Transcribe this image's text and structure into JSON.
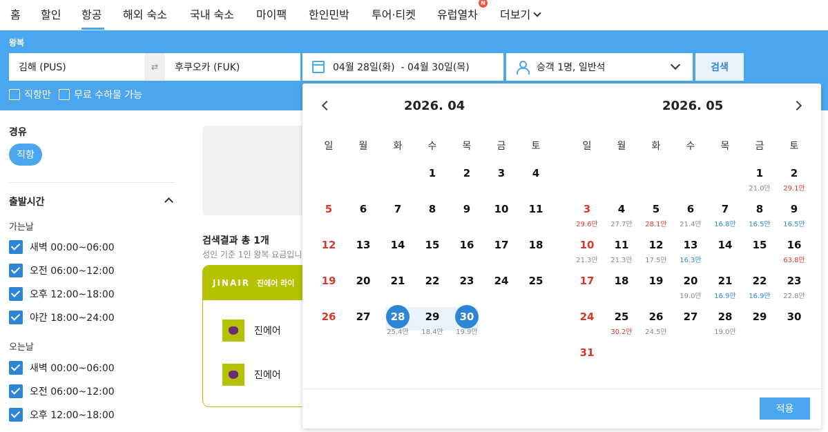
{
  "nav": {
    "items": [
      "홈",
      "할인",
      "항공",
      "해외 숙소",
      "국내 숙소",
      "마이팩",
      "한인민박",
      "투어·티켓",
      "유럽열차",
      "더보기"
    ],
    "active": "항공",
    "badge": "N"
  },
  "search": {
    "trip_type": "왕복",
    "origin": "김해 (PUS)",
    "destination": "후쿠오카 (FUK)",
    "dates": "04월 28일(화)  - 04월 30일(목)",
    "passengers": "승객 1명, 일반석",
    "search_label": "검색",
    "direct_only": "직항만",
    "free_baggage": "무료 수하물 가능"
  },
  "filters": {
    "stops_title": "경유",
    "stops_pill": "직항",
    "departure_title": "출발시간",
    "outbound_label": "가는날",
    "return_label": "오는날",
    "outbound": [
      "새벽 00:00~06:00",
      "오전 06:00~12:00",
      "오후 12:00~18:00",
      "야간 18:00~24:00"
    ],
    "return": [
      "새벽 00:00~06:00",
      "오전 06:00~12:00",
      "오후 12:00~18:00"
    ]
  },
  "results": {
    "title": "검색결과 총 1개",
    "subtitle": "성인 기준 1인 왕복 요금입니",
    "card_logo": "JINAIR",
    "card_head": "진에어 라이",
    "airlines": [
      "진에어",
      "진에어"
    ]
  },
  "calendar": {
    "weekdays": [
      "일",
      "월",
      "화",
      "수",
      "목",
      "금",
      "토"
    ],
    "apply_label": "적용",
    "months": [
      {
        "title": "2026. 04",
        "weeks": [
          [
            null,
            null,
            null,
            {
              "d": "1"
            },
            {
              "d": "2"
            },
            {
              "d": "3"
            },
            {
              "d": "4"
            }
          ],
          [
            {
              "d": "5"
            },
            {
              "d": "6"
            },
            {
              "d": "7"
            },
            {
              "d": "8"
            },
            {
              "d": "9"
            },
            {
              "d": "10"
            },
            {
              "d": "11"
            }
          ],
          [
            {
              "d": "12"
            },
            {
              "d": "13"
            },
            {
              "d": "14"
            },
            {
              "d": "15"
            },
            {
              "d": "16"
            },
            {
              "d": "17"
            },
            {
              "d": "18"
            }
          ],
          [
            {
              "d": "19"
            },
            {
              "d": "20"
            },
            {
              "d": "21"
            },
            {
              "d": "22"
            },
            {
              "d": "23"
            },
            {
              "d": "24"
            },
            {
              "d": "25"
            }
          ],
          [
            {
              "d": "26"
            },
            {
              "d": "27"
            },
            {
              "d": "28",
              "p": "25.4만",
              "sel": true
            },
            {
              "d": "29",
              "p": "18.4만"
            },
            {
              "d": "30",
              "p": "19.9만",
              "sel": true
            },
            null,
            null
          ]
        ]
      },
      {
        "title": "2026. 05",
        "weeks": [
          [
            null,
            null,
            null,
            null,
            null,
            {
              "d": "1",
              "p": "21.0만"
            },
            {
              "d": "2",
              "p": "29.1만",
              "pc": "red"
            }
          ],
          [
            {
              "d": "3",
              "p": "29.6만",
              "pc": "red"
            },
            {
              "d": "4",
              "p": "27.7만"
            },
            {
              "d": "5",
              "p": "28.1만",
              "pc": "red"
            },
            {
              "d": "6",
              "p": "21.4만"
            },
            {
              "d": "7",
              "p": "16.8만",
              "pc": "blue"
            },
            {
              "d": "8",
              "p": "16.5만",
              "pc": "blue"
            },
            {
              "d": "9",
              "p": "16.5만",
              "pc": "blue"
            }
          ],
          [
            {
              "d": "10",
              "p": "21.3만"
            },
            {
              "d": "11",
              "p": "21.3만"
            },
            {
              "d": "12",
              "p": "17.5만"
            },
            {
              "d": "13",
              "p": "16.3만",
              "pc": "blue"
            },
            {
              "d": "14"
            },
            {
              "d": "15"
            },
            {
              "d": "16",
              "p": "63.8만",
              "pc": "red"
            }
          ],
          [
            {
              "d": "17"
            },
            {
              "d": "18"
            },
            {
              "d": "19"
            },
            {
              "d": "20",
              "p": "19.0만"
            },
            {
              "d": "21",
              "p": "16.9만",
              "pc": "blue"
            },
            {
              "d": "22",
              "p": "16.9만",
              "pc": "blue"
            },
            {
              "d": "23",
              "p": "22.8만"
            }
          ],
          [
            {
              "d": "24"
            },
            {
              "d": "25",
              "p": "30.2만",
              "pc": "red"
            },
            {
              "d": "26",
              "p": "24.5만"
            },
            {
              "d": "27"
            },
            {
              "d": "28",
              "p": "19.0만"
            },
            {
              "d": "29"
            },
            {
              "d": "30"
            }
          ],
          [
            {
              "d": "31"
            },
            null,
            null,
            null,
            null,
            null,
            null
          ]
        ]
      }
    ]
  },
  "colors": {
    "primary": "#4aa6ee",
    "selected": "#2d86d5",
    "holiday": "#d9392b",
    "cheap": "#2d86d5",
    "jinair": "#b5c200"
  }
}
